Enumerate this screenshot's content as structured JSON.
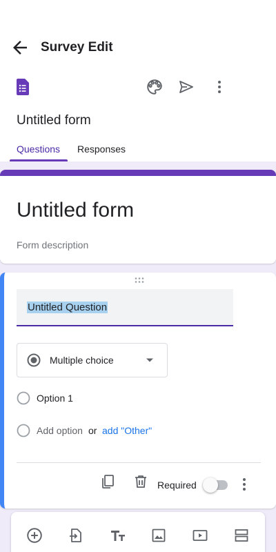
{
  "appbar": {
    "title": "Survey Edit",
    "icons": [
      "arrow-back-icon",
      "forms-logo-icon",
      "palette-icon",
      "send-icon",
      "more-vert-icon"
    ]
  },
  "form_name": "Untitled form",
  "tabs": [
    {
      "label": "Questions",
      "active": true
    },
    {
      "label": "Responses",
      "active": false
    }
  ],
  "title_card": {
    "title": "Untitled form",
    "description": "Form description"
  },
  "question": {
    "text": "Untitled Question",
    "type": "Multiple choice",
    "options": [
      {
        "label": "Option 1"
      }
    ],
    "add_option_label": "Add option",
    "or_label": "or",
    "add_other_label": "add \"Other\"",
    "required_label": "Required",
    "required": false
  },
  "toolbar_icons": [
    "add-circle-icon",
    "import-icon",
    "title-text-icon",
    "image-icon",
    "video-icon",
    "section-icon"
  ],
  "colors": {
    "accent": "#673ab7",
    "tab_active": "#4b2aa6",
    "question_border": "#4285f4",
    "link": "#1a73e8",
    "background": "#f0ebf8"
  }
}
